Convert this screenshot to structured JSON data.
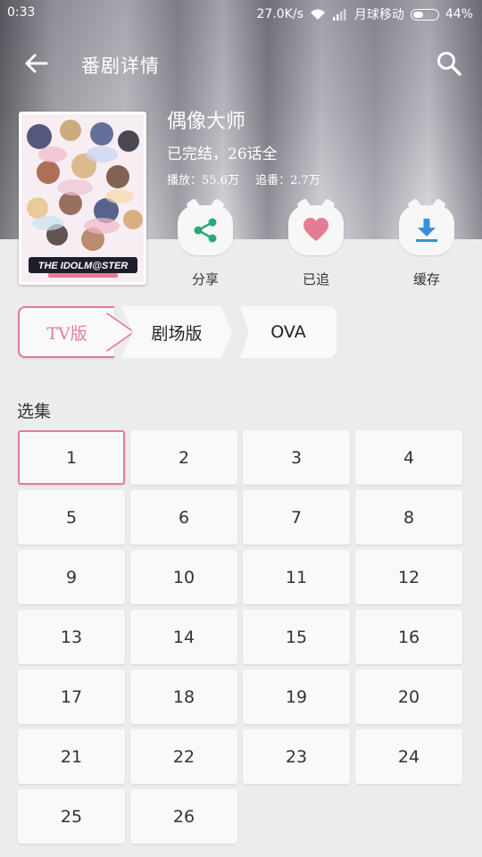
{
  "status_bar": {
    "time": "0:33",
    "network_speed": "27.0K/s",
    "carrier": "月球移动",
    "battery": "44%",
    "battery_level": 0.44
  },
  "toolbar": {
    "title": "番剧详情"
  },
  "anime": {
    "title": "偶像大师",
    "status": "已完结，26话全",
    "plays": "播放：55.6万",
    "follows": "追番：2.7万",
    "cover_logo_text": "THE IDOLM@STER"
  },
  "actions": [
    {
      "label": "分享",
      "icon": "share-icon",
      "color": "#2aa876"
    },
    {
      "label": "已追",
      "icon": "heart-icon",
      "color": "#e47c95"
    },
    {
      "label": "缓存",
      "icon": "download-icon",
      "color": "#3b8fd6"
    }
  ],
  "version_tabs": [
    {
      "label": "TV版",
      "selected": true
    },
    {
      "label": "剧场版",
      "selected": false
    },
    {
      "label": "OVA",
      "selected": false
    }
  ],
  "episodes": {
    "section_title": "选集",
    "selected": "1",
    "items": [
      "1",
      "2",
      "3",
      "4",
      "5",
      "6",
      "7",
      "8",
      "9",
      "10",
      "11",
      "12",
      "13",
      "14",
      "15",
      "16",
      "17",
      "18",
      "19",
      "20",
      "21",
      "22",
      "23",
      "24",
      "25",
      "26"
    ]
  },
  "colors": {
    "accent": "#e47c95",
    "share": "#2aa876",
    "download": "#3b8fd6",
    "background": "#ececec"
  }
}
